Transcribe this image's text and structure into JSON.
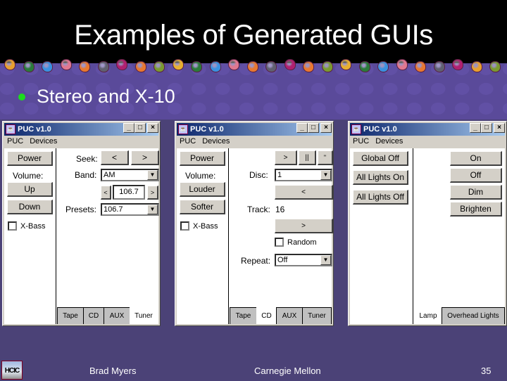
{
  "slide": {
    "title": "Examples of Generated GUIs",
    "bullet": "Stereo and X-10",
    "bullet_color": "#1cdc1c",
    "footer": {
      "logo": "HCIC",
      "author": "Brad Myers",
      "institution": "Carnegie Mellon",
      "page_number": "35"
    }
  },
  "window_common": {
    "title": "PUC v1.0",
    "menu": [
      "PUC",
      "Devices"
    ],
    "controls": {
      "minimize": "_",
      "maximize": "□",
      "close": "×"
    }
  },
  "tuner_window": {
    "left": {
      "power": "Power",
      "volume_label": "Volume:",
      "up": "Up",
      "down": "Down",
      "xbass": "X-Bass",
      "xbass_checked": false
    },
    "right": {
      "seek_label": "Seek:",
      "seek_back": "<",
      "seek_fwd": ">",
      "band_label": "Band:",
      "band_value": "AM",
      "station_down": "<",
      "station_value": "106.7",
      "station_up": ">",
      "presets_label": "Presets:",
      "presets_value": "106.7"
    },
    "tabs": [
      "Tape",
      "CD",
      "AUX",
      "Tuner"
    ],
    "active_tab": "Tuner"
  },
  "cd_window": {
    "left": {
      "power": "Power",
      "volume_label": "Volume:",
      "louder": "Louder",
      "softer": "Softer",
      "xbass": "X-Bass",
      "xbass_checked": false
    },
    "right": {
      "play": ">",
      "pause": "||",
      "stop": "\"",
      "disc_label": "Disc:",
      "disc_value": "1",
      "prev_track": "<",
      "track_label": "Track:",
      "track_value": "16",
      "next_track": ">",
      "random": "Random",
      "random_checked": false,
      "repeat_label": "Repeat:",
      "repeat_value": "Off"
    },
    "tabs": [
      "Tape",
      "CD",
      "AUX",
      "Tuner"
    ],
    "active_tab": "CD"
  },
  "x10_window": {
    "left": {
      "global_off": "Global Off",
      "all_on": "All Lights On",
      "all_off": "All Lights Off"
    },
    "right": {
      "on": "On",
      "off": "Off",
      "dim": "Dim",
      "brighten": "Brighten"
    },
    "tabs": [
      "Lamp",
      "Overhead Lights"
    ],
    "active_tab": "Lamp"
  }
}
